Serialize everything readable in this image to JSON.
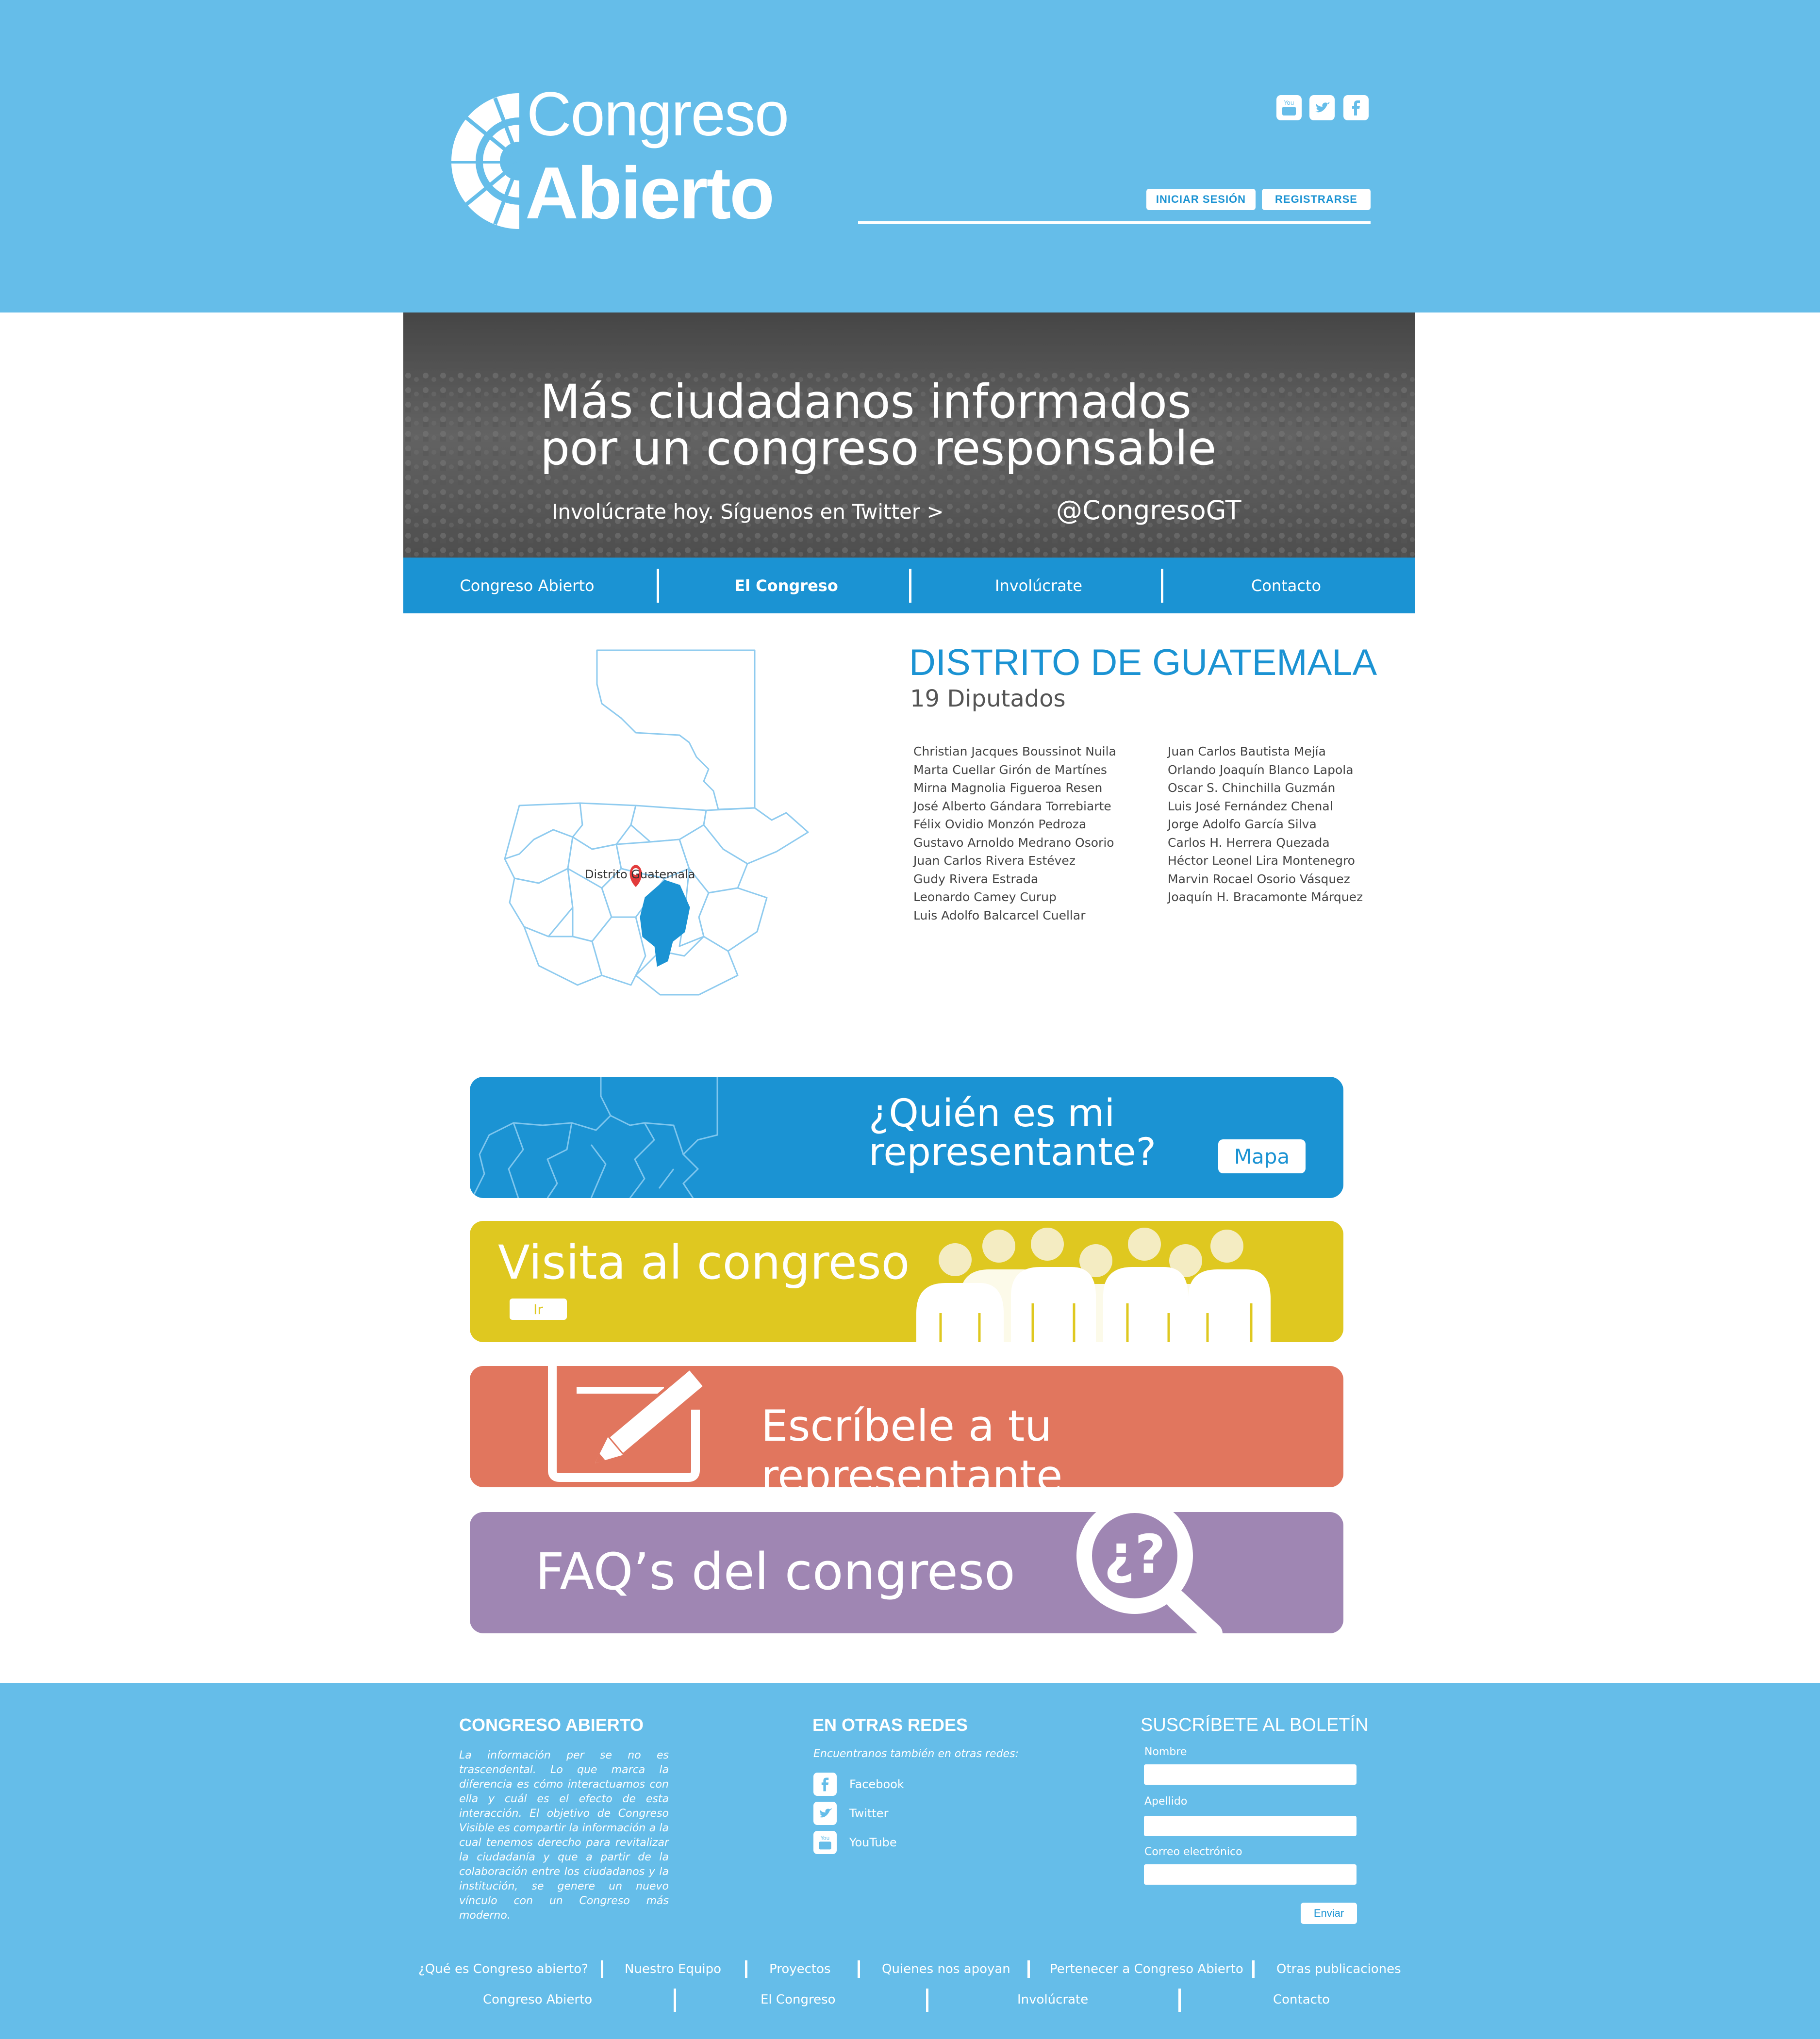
{
  "brand": {
    "line1": "Congreso",
    "line2": "Abierto"
  },
  "header": {
    "social": [
      "youtube-icon",
      "twitter-icon",
      "facebook-icon"
    ],
    "login_label": "INICIAR SESIÓN",
    "register_label": "REGISTRARSE"
  },
  "hero": {
    "title_line1": "Más ciudadanos informados",
    "title_line2": "por un congreso responsable",
    "subtitle": "Involúcrate hoy. Síguenos en Twitter  >",
    "handle": "@CongresoGT"
  },
  "nav": [
    "Congreso Abierto",
    "El Congreso",
    "Involúcrate",
    "Contacto"
  ],
  "nav_active": "El Congreso",
  "district": {
    "map_label": "Distrito Guatemala",
    "title": "DISTRITO DE GUATEMALA",
    "count": "19 Diputados",
    "col1": [
      "Christian Jacques Boussinot Nuila",
      "Marta Cuellar Girón de Martínes",
      "Mirna Magnolia Figueroa Resen",
      "José Alberto Gándara Torrebiarte",
      "Félix Ovidio Monzón Pedroza",
      "Gustavo Arnoldo Medrano Osorio",
      "Juan Carlos Rivera Estévez",
      "Gudy Rivera Estrada",
      "Leonardo Camey Curup",
      "Luis Adolfo Balcarcel Cuellar"
    ],
    "col2": [
      "Juan Carlos Bautista Mejía",
      "Orlando Joaquín Blanco Lapola",
      "Oscar S. Chinchilla Guzmán",
      "Luis José Fernández Chenal",
      "Jorge Adolfo García Silva",
      "Carlos H. Herrera Quezada",
      "Héctor Leonel Lira Montenegro",
      "Marvin Rocael Osorio Vásquez",
      "Joaquín H. Bracamonte Márquez"
    ]
  },
  "banners": {
    "representative": {
      "line1": "¿Quién es mi",
      "line2": "representante?",
      "button": "Mapa"
    },
    "visit": {
      "title": "Visita al congreso",
      "button": "Ir"
    },
    "write": {
      "title": "Escríbele a tu representante"
    },
    "faq": {
      "title": "FAQ’s del congreso",
      "icon_text": "¿?"
    }
  },
  "colors": {
    "header": "#65bde9",
    "accent": "#1b93d3",
    "yellow": "#dfc820",
    "coral": "#e1765e",
    "purple": "#9f86b3"
  },
  "footer": {
    "about_heading": "CONGRESO ABIERTO",
    "about_text": "La información per se no es trascendental. Lo que marca la diferencia es cómo interactuamos con ella y cuál es el efecto de esta interacción. El objetivo de Congreso Visible es compartir la información a la cual tenemos derecho para revitalizar la ciudadanía y que a partir de la colaboración entre los ciudadanos y la institución, se genere un nuevo vínculo con un Congreso más moderno.",
    "networks_heading": "EN OTRAS REDES",
    "networks_intro": "Encuentranos también en otras redes:",
    "networks": [
      "Facebook",
      "Twitter",
      "YouTube"
    ],
    "newsletter_heading": "SUSCRÍBETE AL BOLETÍN",
    "fields": [
      "Nombre",
      "Apellido",
      "Correo electrónico"
    ],
    "send_label": "Enviar",
    "links_row1": [
      "¿Qué es Congreso abierto?",
      "Nuestro Equipo",
      "Proyectos",
      "Quienes nos apoyan",
      "Pertenecer a Congreso Abierto",
      "Otras publicaciones"
    ],
    "links_row2": [
      "Congreso Abierto",
      "El Congreso",
      "Involúcrate",
      "Contacto"
    ]
  }
}
